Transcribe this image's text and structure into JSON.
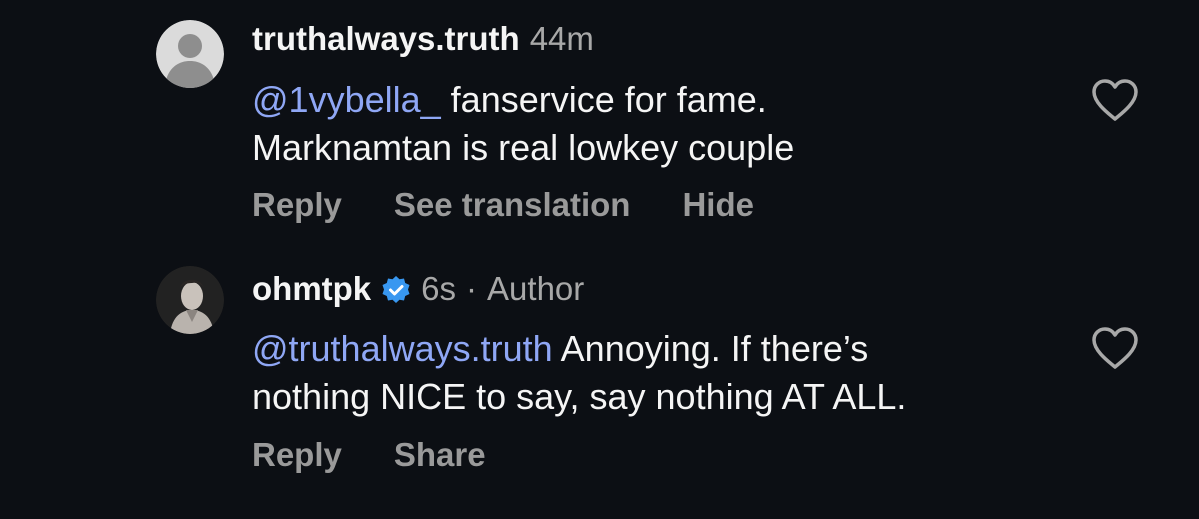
{
  "comments": [
    {
      "username": "truthalways.truth",
      "time": "44m",
      "mention": "@1vybella_",
      "text_line1": "fanservice for fame.",
      "text_line2": "Marknamtan is real lowkey couple",
      "actions": {
        "reply": "Reply",
        "see_translation": "See translation",
        "hide": "Hide"
      },
      "avatar": "default-avatar-icon",
      "like_icon": "heart-outline-icon"
    },
    {
      "username": "ohmtpk",
      "verified": true,
      "time": "6s",
      "separator": "·",
      "author_label": "Author",
      "mention": "@truthalways.truth",
      "text_line1": "Annoying. If there’s",
      "text_line2": "nothing NICE to say, say nothing AT ALL.",
      "actions": {
        "reply": "Reply",
        "share": "Share"
      },
      "avatar": "profile-photo",
      "like_icon": "heart-outline-icon"
    }
  ],
  "colors": {
    "background": "#0c0f14",
    "text": "#f5f5f5",
    "secondary": "#a8a8a8",
    "mention": "#8fa7f5",
    "verified": "#3897f0"
  }
}
